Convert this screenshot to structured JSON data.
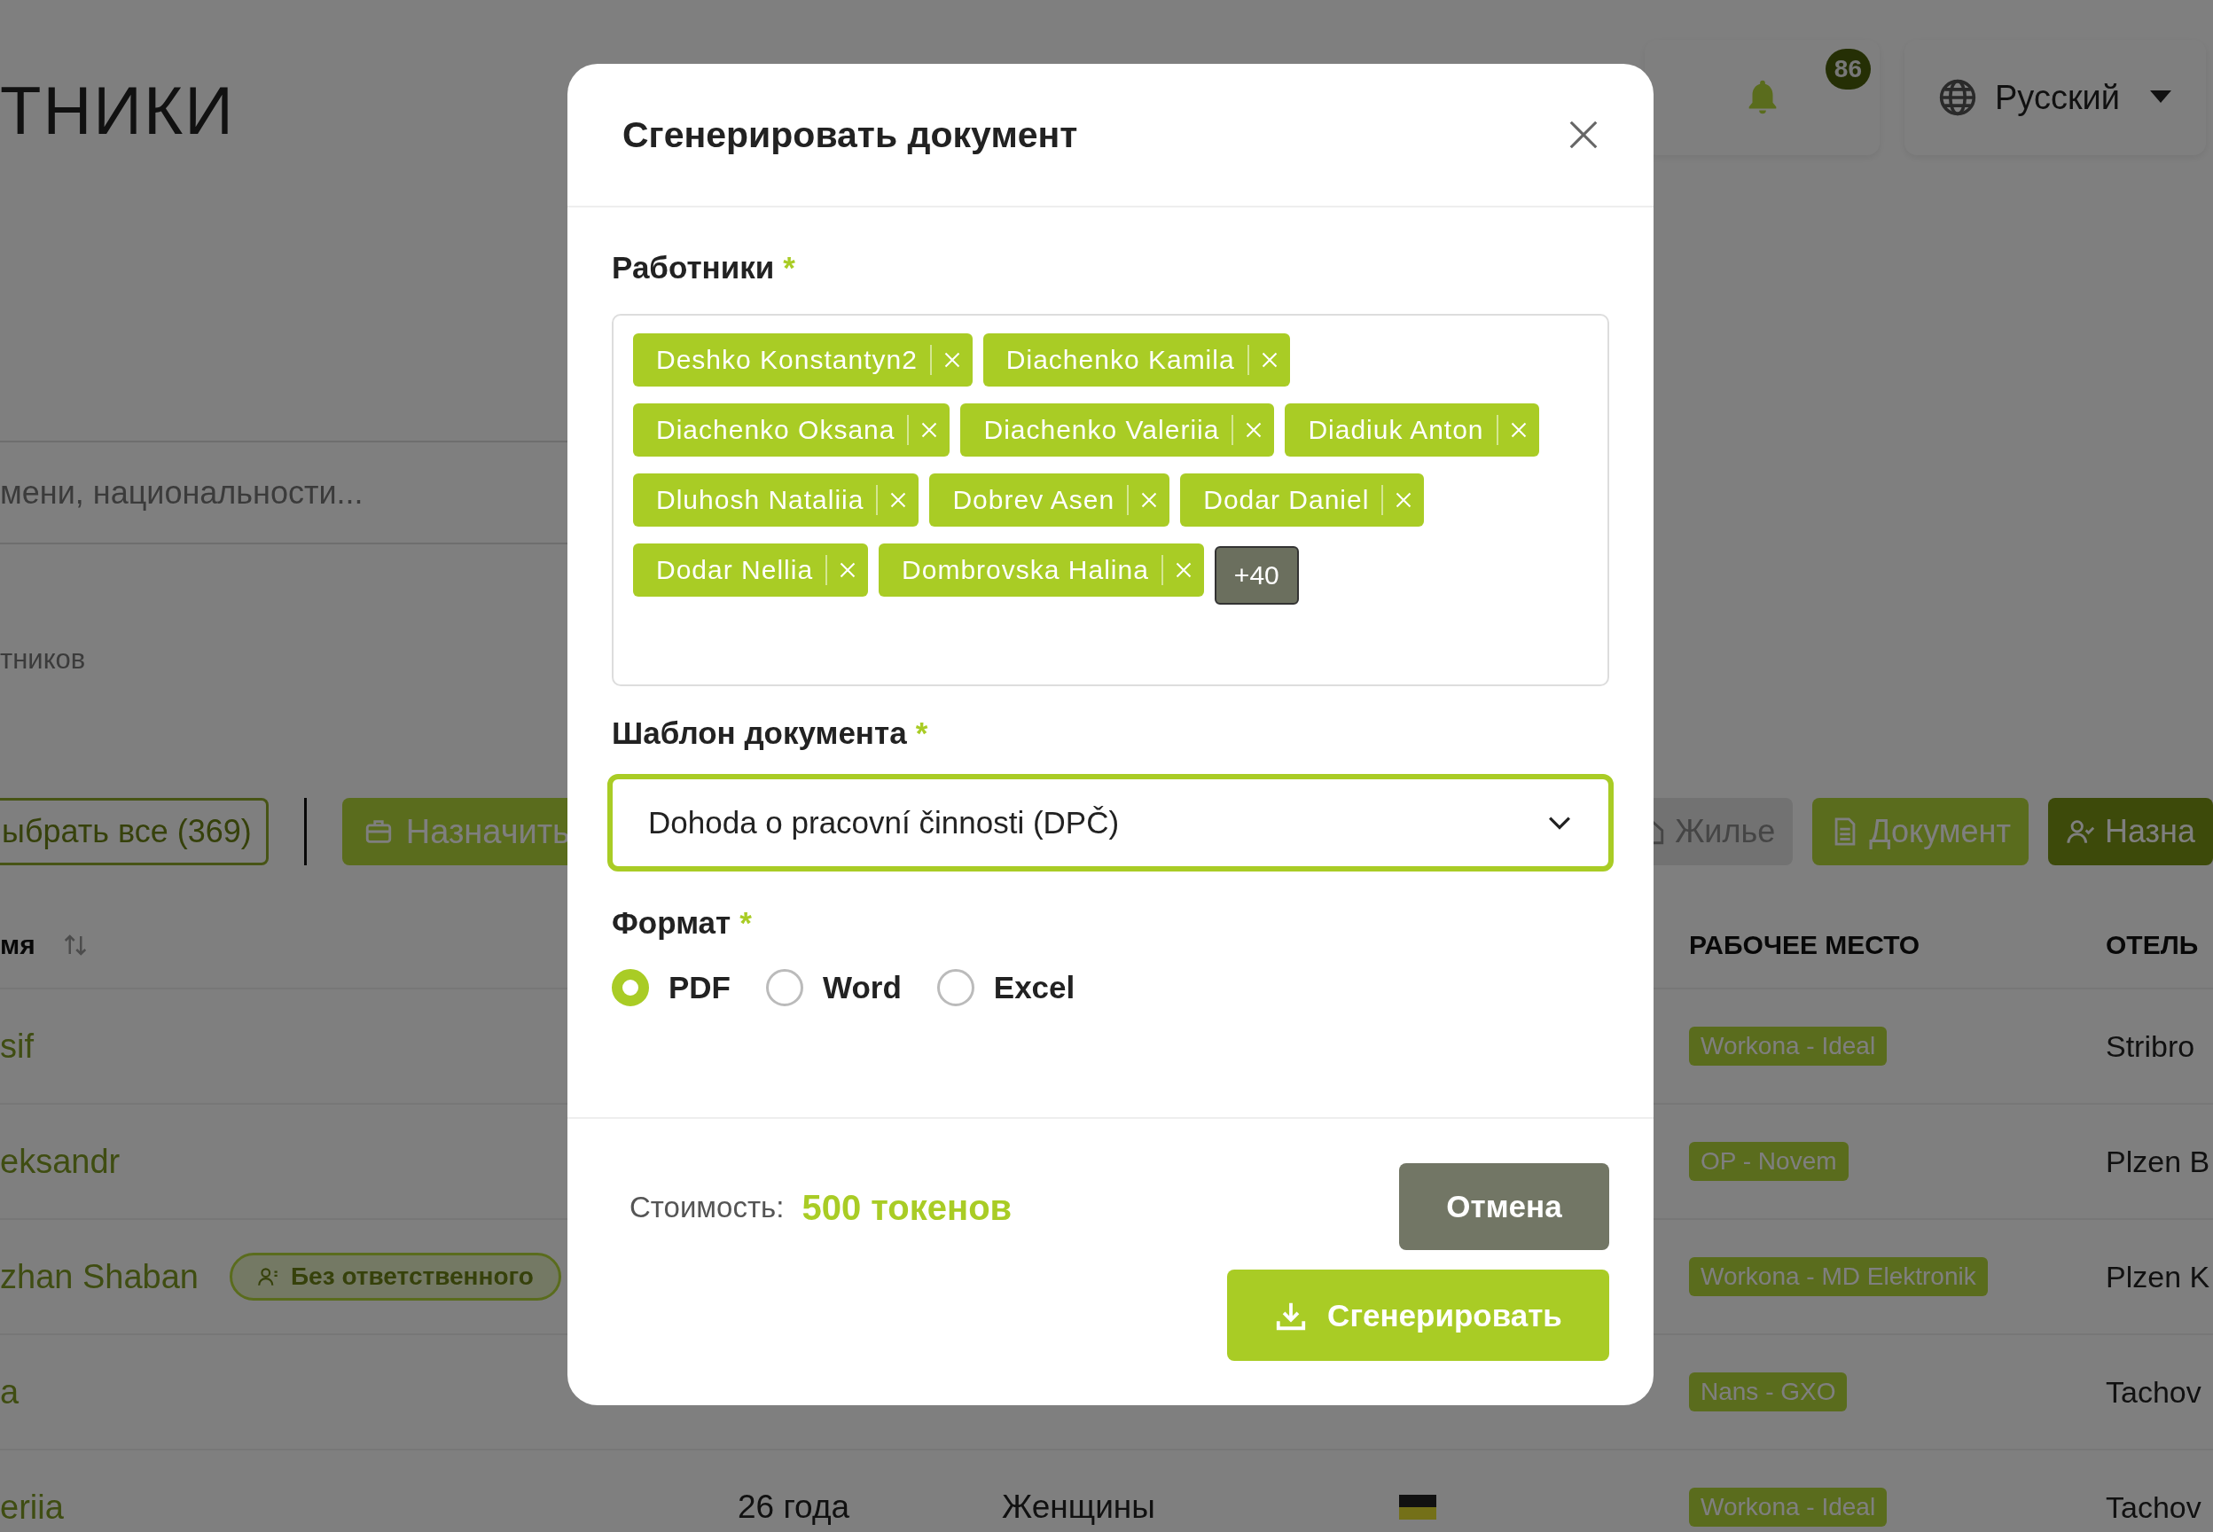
{
  "page": {
    "title": "ТНИКИ",
    "notifications": {
      "count": "86"
    },
    "language": "Русский",
    "search": {
      "placeholder": "мени, национальности..."
    },
    "subtitle": "тников",
    "left_actions": [
      {
        "kind": "outline",
        "label": "ыбрать все (369)"
      },
      {
        "kind": "primary",
        "label": "Назначить"
      }
    ],
    "right_actions": [
      {
        "kind": "muted",
        "label": "Жилье"
      },
      {
        "kind": "primary",
        "label": "Документ"
      },
      {
        "kind": "dark",
        "label": "Назна"
      }
    ],
    "table": {
      "columns": [
        {
          "label": "мя",
          "sortable": true
        },
        {
          "label": "РАБОЧЕЕ МЕСТО"
        },
        {
          "label": "ОТЕЛЬ"
        }
      ],
      "rows": [
        {
          "name": "sif",
          "workplace": "Workona - Ideal",
          "hotel": "Stribro"
        },
        {
          "name": "eksandr",
          "workplace": "OP - Novem",
          "hotel": "Plzen B"
        },
        {
          "name": "zhan Shaban",
          "badge": "Без ответственного",
          "workplace": "Workona - MD Elektronik",
          "hotel": "Plzen K"
        },
        {
          "name": "a",
          "workplace": "Nans - GXO",
          "hotel": "Tachov"
        },
        {
          "name": "eriia",
          "age": "26 года",
          "gender": "Женщины",
          "flag": true,
          "workplace": "Workona - Ideal",
          "hotel": "Tachov"
        }
      ]
    }
  },
  "dialog": {
    "title": "Сгенерировать документ",
    "workers": {
      "label": "Работники",
      "required_mark": "*",
      "tags": [
        "Deshko Konstantyn2",
        "Diachenko Kamila",
        "Diachenko Oksana",
        "Diachenko Valeriia",
        "Diadiuk Anton",
        "Dluhosh Nataliia",
        "Dobrev Asen",
        "Dodar Daniel",
        "Dodar Nellia",
        "Dombrovska Halina"
      ],
      "more": "+40"
    },
    "template": {
      "label": "Шаблон документа",
      "required_mark": "*",
      "value": "Dohoda o pracovní činnosti (DPČ)"
    },
    "format": {
      "label": "Формат",
      "required_mark": "*",
      "options": [
        {
          "label": "PDF",
          "selected": true
        },
        {
          "label": "Word",
          "selected": false
        },
        {
          "label": "Excel",
          "selected": false
        }
      ]
    },
    "cost": {
      "label": "Стоимость:",
      "value": "500 токенов"
    },
    "buttons": [
      {
        "kind": "secondary",
        "label": "Отмена"
      },
      {
        "kind": "primary",
        "label": "Сгенерировать"
      }
    ]
  }
}
